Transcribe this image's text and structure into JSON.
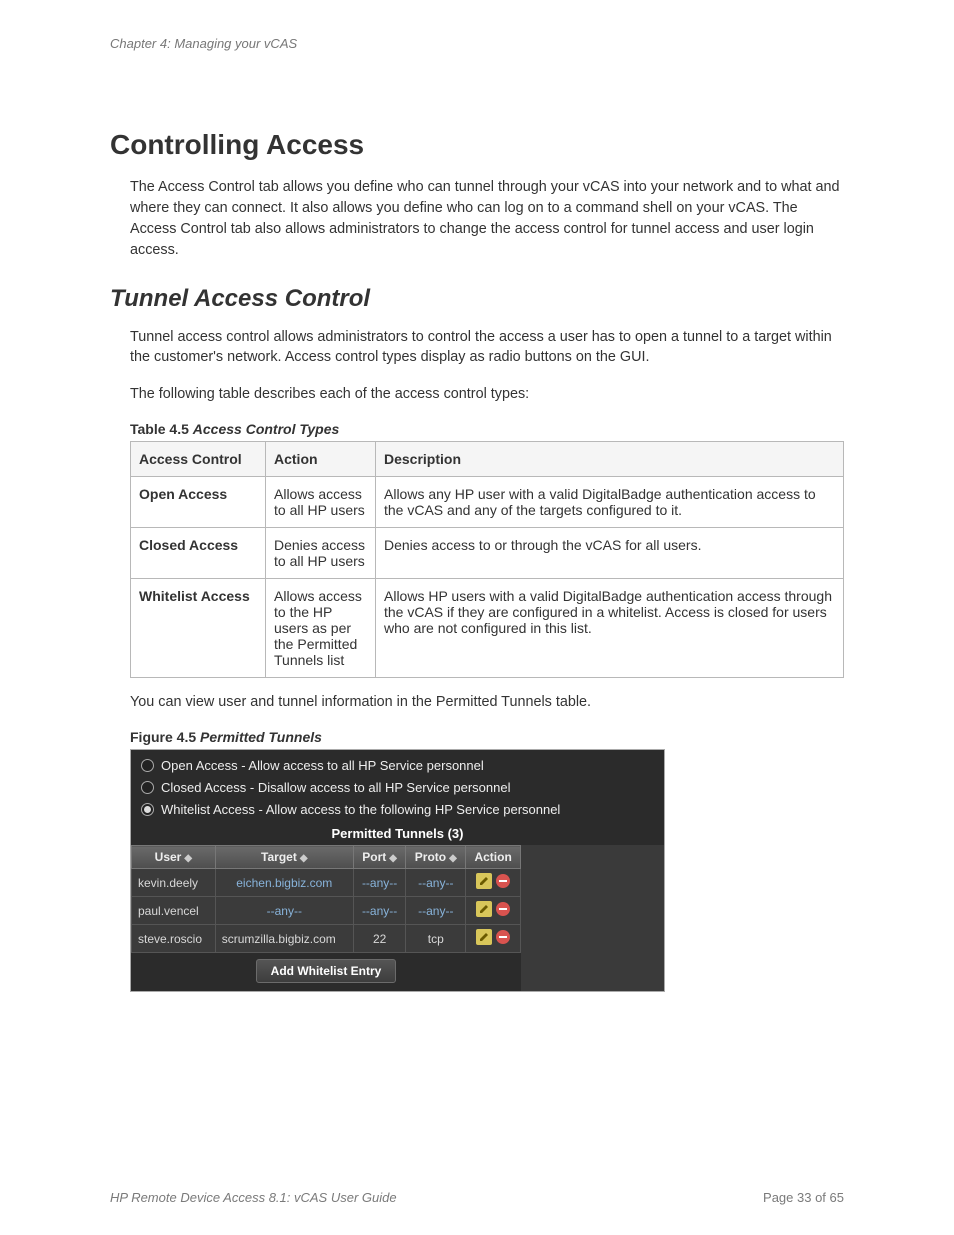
{
  "chapter": "Chapter 4: Managing your vCAS",
  "h1": "Controlling Access",
  "intro": "The Access Control tab allows you define who can tunnel through your vCAS into your network and to what and where they can connect. It also allows you define who can log on to a command shell on your vCAS. The Access Control tab also allows administrators to change the access control for tunnel access and user login access.",
  "h2": "Tunnel Access Control",
  "p1": "Tunnel access control allows administrators to control the access a user has to open a tunnel to a target within the customer's network. Access control types display as radio buttons on the GUI.",
  "p2": "The following table describes each of the access control types:",
  "table_caption_lbl": "Table 4.5 ",
  "table_caption_ttl": "Access Control Types",
  "table": {
    "headers": {
      "c1": "Access Control",
      "c2": "Action",
      "c3": "Description"
    },
    "rows": [
      {
        "c1": "Open Access",
        "c2": "Allows access to all HP users",
        "c3": "Allows any HP user with a valid DigitalBadge authentication access to the vCAS and any of the targets configured to it."
      },
      {
        "c1": "Closed Access",
        "c2": "Denies access to all HP users",
        "c3": "Denies access to or through the vCAS for all users."
      },
      {
        "c1": "Whitelist Access",
        "c2": "Allows access to the HP users as per the Permitted Tunnels list",
        "c3": "Allows HP users with a valid DigitalBadge authentication access through the vCAS if they are configured in a whitelist. Access is closed for users who are not configured in this list."
      }
    ]
  },
  "p3": "You can view user and tunnel information in the Permitted Tunnels table.",
  "fig_caption_lbl": "Figure 4.5 ",
  "fig_caption_ttl": "Permitted Tunnels",
  "fig": {
    "radios": [
      {
        "label": "Open Access - Allow access to all HP Service personnel",
        "selected": false
      },
      {
        "label": "Closed Access - Disallow access to all HP Service personnel",
        "selected": false
      },
      {
        "label": "Whitelist Access - Allow access to the following HP Service personnel",
        "selected": true
      }
    ],
    "tunnels_title": "Permitted Tunnels (3)",
    "headers": {
      "user": "User",
      "target": "Target",
      "port": "Port",
      "proto": "Proto",
      "action": "Action"
    },
    "rows": [
      {
        "user": "kevin.deely",
        "target": "eichen.bigbiz.com",
        "port": "--any--",
        "proto": "--any--"
      },
      {
        "user": "paul.vencel",
        "target": "--any--",
        "port": "--any--",
        "proto": "--any--"
      },
      {
        "user": "steve.roscio",
        "target": "scrumzilla.bigbiz.com",
        "port": "22",
        "proto": "tcp"
      }
    ],
    "add_btn": "Add Whitelist Entry"
  },
  "footer_left": "HP Remote Device Access 8.1: vCAS User Guide",
  "footer_right": "Page 33 of 65"
}
